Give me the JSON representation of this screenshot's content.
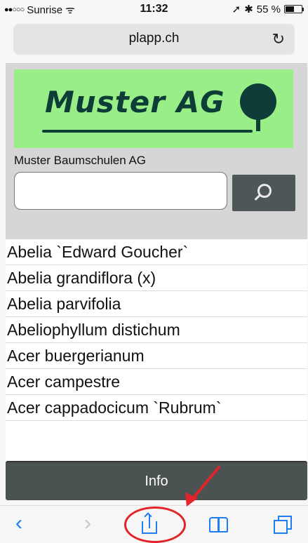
{
  "status_bar": {
    "carrier": "Sunrise",
    "time": "11:32",
    "battery": "55 %",
    "battery_level": 0.55
  },
  "browser": {
    "url": "plapp.ch",
    "reload_icon": "reload-icon"
  },
  "page": {
    "logo_text": "Muster AG",
    "company_name": "Muster Baumschulen AG",
    "search": {
      "value": "",
      "button_icon": "search-icon"
    },
    "plants": [
      "Abelia `Edward Goucher`",
      "Abelia grandiflora (x)",
      "Abelia parvifolia",
      "Abeliophyllum distichum",
      "Acer buergerianum",
      "Acer campestre",
      "Acer cappadocicum `Rubrum`"
    ],
    "info_label": "Info"
  },
  "toolbar": {
    "back": "‹",
    "forward": "›",
    "icons": [
      "back-icon",
      "forward-icon",
      "share-icon",
      "bookmarks-icon",
      "tabs-icon"
    ]
  },
  "colors": {
    "logo_bg": "#99ee88",
    "logo_fg": "#0e3d38",
    "dark_button": "#4d5757",
    "ios_blue": "#1e7cf5",
    "annotation": "#e3232a"
  }
}
